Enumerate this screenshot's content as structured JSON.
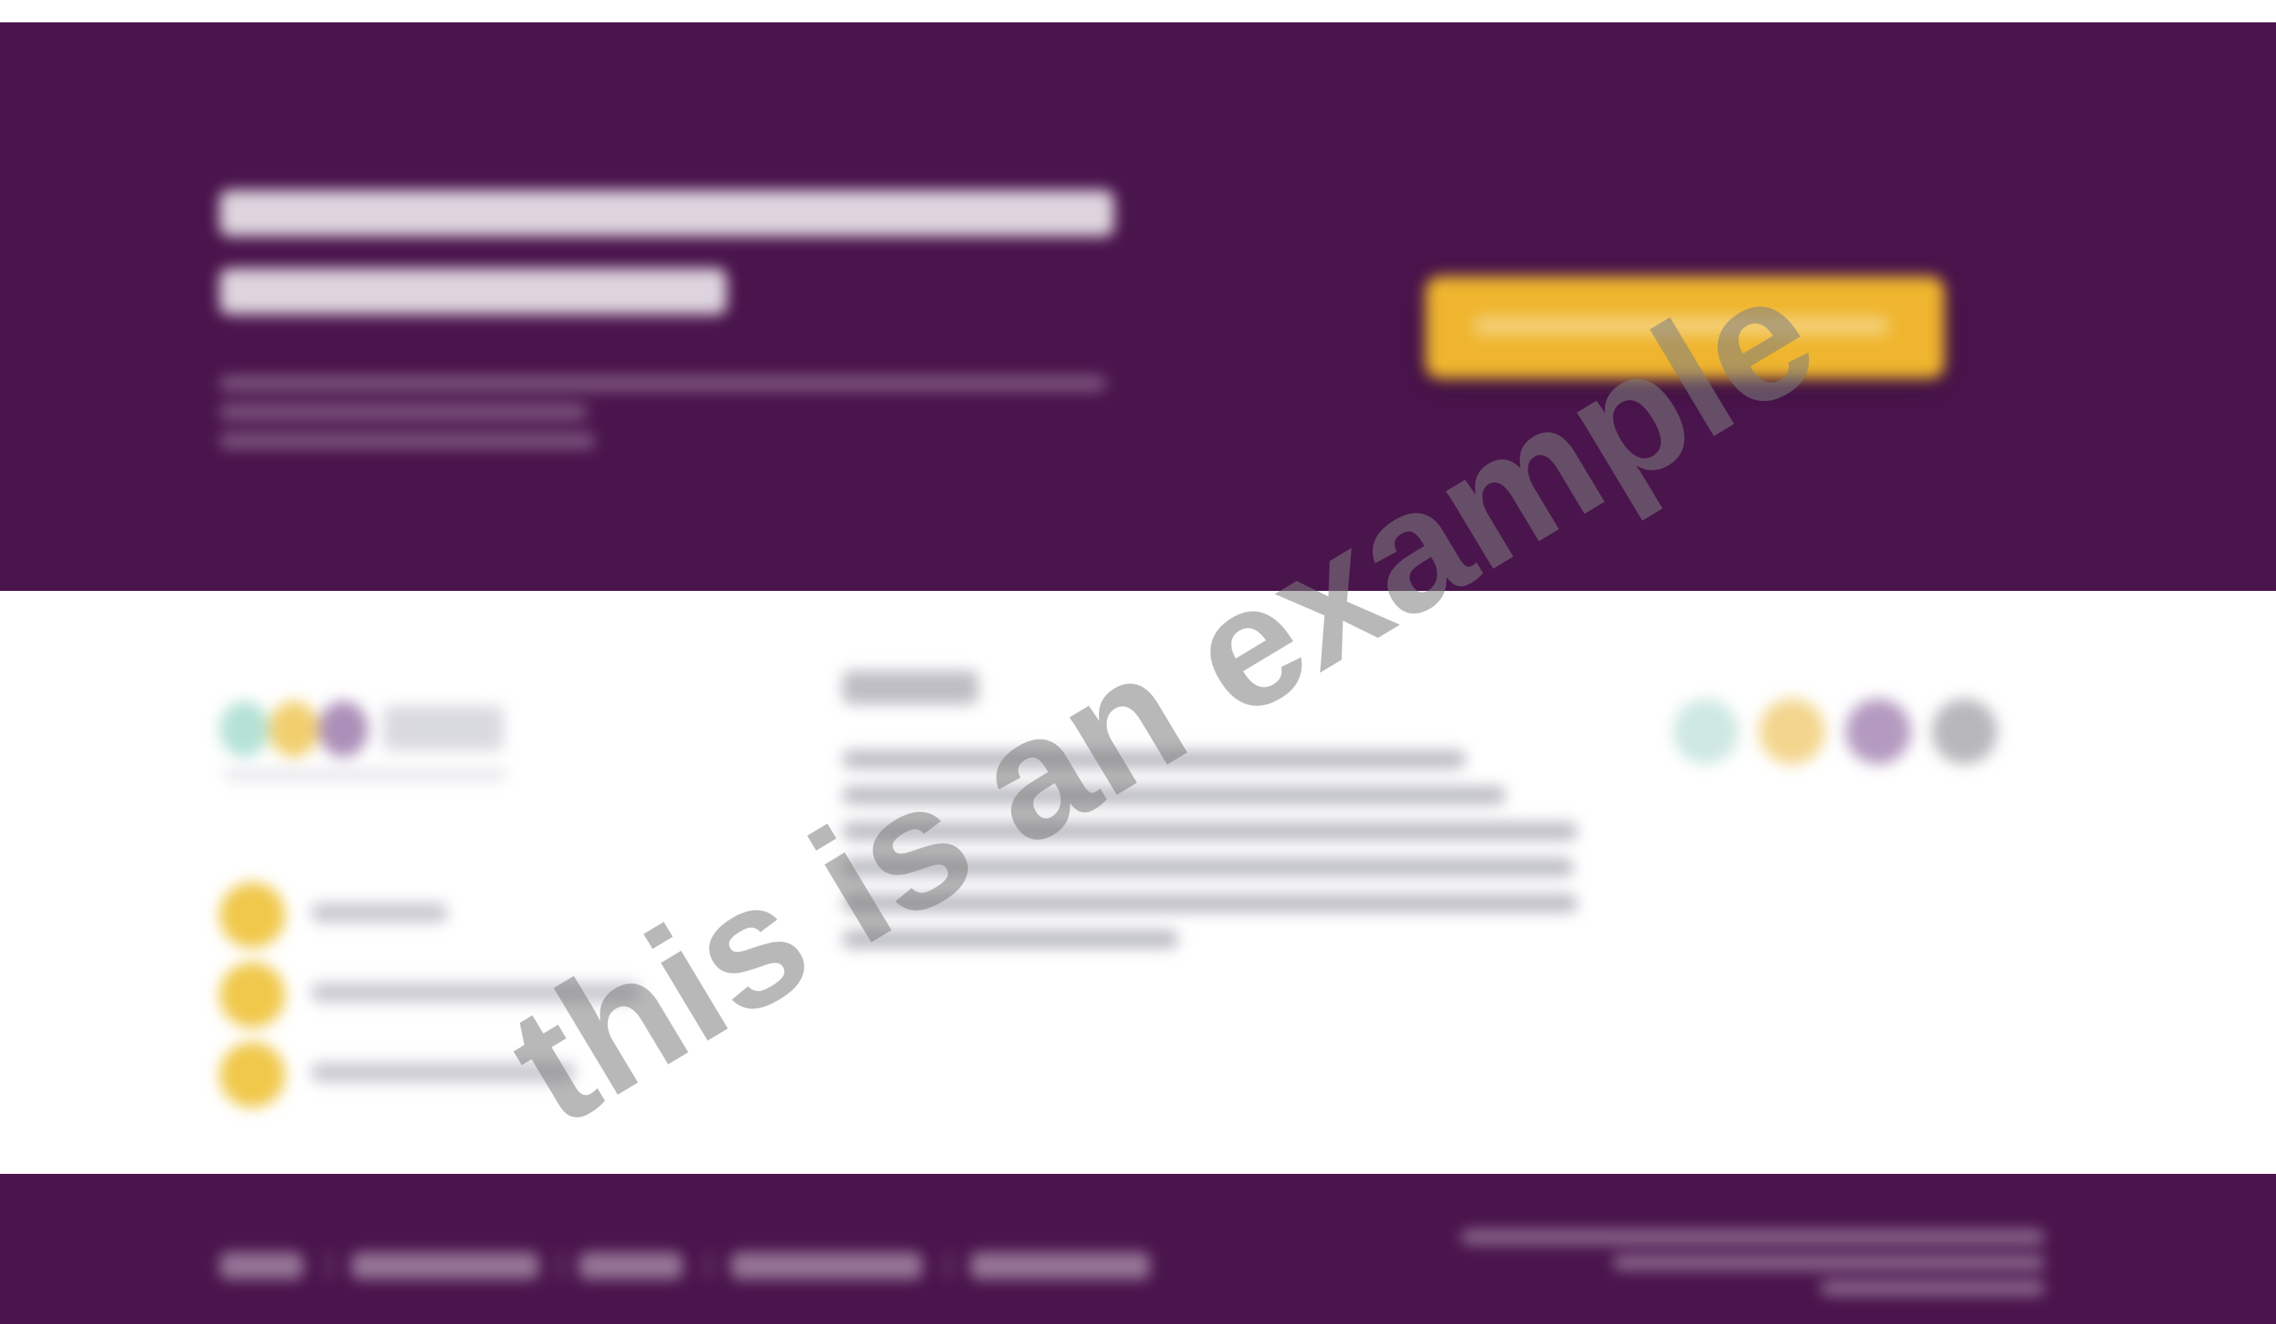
{
  "hero": {
    "title": "",
    "subtitle": "",
    "cta_label": ""
  },
  "about": {
    "heading": "",
    "body": ""
  },
  "features": [
    {
      "label": ""
    },
    {
      "label": ""
    },
    {
      "label": ""
    }
  ],
  "social": [
    {
      "icon": "share-icon-1",
      "color": "#cfe8e2"
    },
    {
      "icon": "share-icon-2",
      "color": "#f3d58d"
    },
    {
      "icon": "share-icon-3",
      "color": "#b49ac0"
    },
    {
      "icon": "share-icon-4",
      "color": "#b8b8bc"
    }
  ],
  "footer": {
    "links": [
      "",
      "",
      "",
      "",
      ""
    ],
    "copyright": ""
  },
  "colors": {
    "brand_purple": "#4a144c",
    "accent_gold": "#efb52e",
    "feature_icon": "#f0c84b"
  },
  "watermark": {
    "text": "this is an example"
  }
}
